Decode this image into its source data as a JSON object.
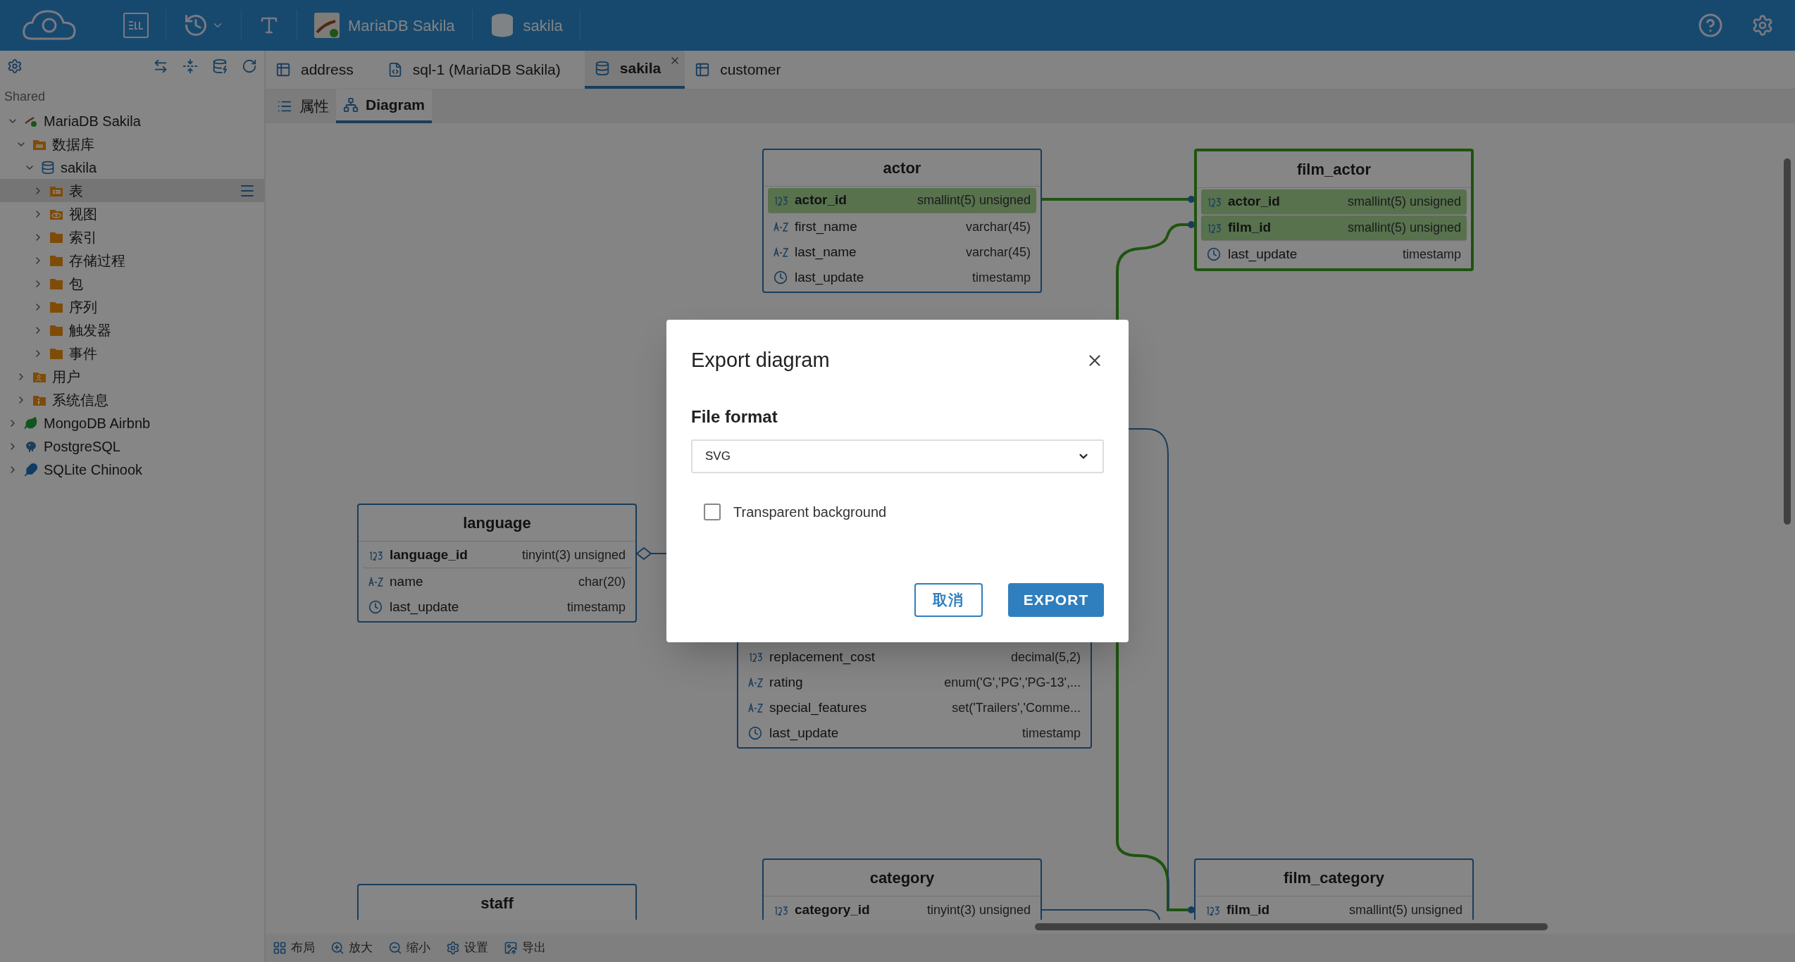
{
  "toolbar": {
    "connection": "MariaDB Sakila",
    "schema": "sakila"
  },
  "sidebar": {
    "section": "Shared",
    "tree": [
      {
        "label": "MariaDB Sakila",
        "kind": "connection",
        "expanded": true,
        "selected": false,
        "children": [
          {
            "label": "数据库",
            "kind": "databases",
            "expanded": true,
            "selected": false,
            "children": [
              {
                "label": "sakila",
                "kind": "database",
                "expanded": true,
                "selected": false,
                "children": [
                  {
                    "label": "表",
                    "kind": "tables",
                    "expanded": false,
                    "selected": true
                  },
                  {
                    "label": "视图",
                    "kind": "views",
                    "expanded": false,
                    "selected": false
                  },
                  {
                    "label": "索引",
                    "kind": "folder",
                    "expanded": false,
                    "selected": false
                  },
                  {
                    "label": "存储过程",
                    "kind": "folder",
                    "expanded": false,
                    "selected": false
                  },
                  {
                    "label": "包",
                    "kind": "folder",
                    "expanded": false,
                    "selected": false
                  },
                  {
                    "label": "序列",
                    "kind": "folder",
                    "expanded": false,
                    "selected": false
                  },
                  {
                    "label": "触发器",
                    "kind": "folder",
                    "expanded": false,
                    "selected": false
                  },
                  {
                    "label": "事件",
                    "kind": "folder",
                    "expanded": false,
                    "selected": false
                  }
                ]
              }
            ]
          },
          {
            "label": "用户",
            "kind": "users",
            "expanded": false,
            "selected": false
          },
          {
            "label": "系统信息",
            "kind": "info",
            "expanded": false,
            "selected": false
          }
        ]
      },
      {
        "label": "MongoDB Airbnb",
        "kind": "mongo",
        "expanded": false,
        "selected": false
      },
      {
        "label": "PostgreSQL",
        "kind": "postgres",
        "expanded": false,
        "selected": false
      },
      {
        "label": "SQLite Chinook",
        "kind": "sqlite",
        "expanded": false,
        "selected": false
      }
    ]
  },
  "tabs": [
    {
      "label": "address",
      "kind": "table",
      "selected": false
    },
    {
      "label": "sql-1 (MariaDB Sakila)",
      "kind": "script",
      "selected": false
    },
    {
      "label": "sakila",
      "kind": "schema",
      "selected": true
    },
    {
      "label": "customer",
      "kind": "table",
      "selected": false
    }
  ],
  "subtabs": [
    {
      "label": "属性",
      "kind": "properties",
      "selected": false
    },
    {
      "label": "Diagram",
      "kind": "diagram",
      "selected": true
    }
  ],
  "diagram": {
    "tables": [
      {
        "name": "actor",
        "highlighted": false,
        "columns": [
          {
            "name": "actor_id",
            "type": "smallint(5) unsigned",
            "kind": "number",
            "key": true,
            "highlighted": true
          },
          {
            "name": "first_name",
            "type": "varchar(45)",
            "kind": "text",
            "key": false,
            "highlighted": false
          },
          {
            "name": "last_name",
            "type": "varchar(45)",
            "kind": "text",
            "key": false,
            "highlighted": false
          },
          {
            "name": "last_update",
            "type": "timestamp",
            "kind": "time",
            "key": false,
            "highlighted": false
          }
        ]
      },
      {
        "name": "film_actor",
        "highlighted": true,
        "columns": [
          {
            "name": "actor_id",
            "type": "smallint(5) unsigned",
            "kind": "number",
            "key": true,
            "highlighted": true
          },
          {
            "name": "film_id",
            "type": "smallint(5) unsigned",
            "kind": "number",
            "key": true,
            "highlighted": true
          },
          {
            "name": "last_update",
            "type": "timestamp",
            "kind": "time",
            "key": false,
            "highlighted": false
          }
        ]
      },
      {
        "name": "language",
        "highlighted": false,
        "columns": [
          {
            "name": "language_id",
            "type": "tinyint(3) unsigned",
            "kind": "number",
            "key": true,
            "highlighted": false
          },
          {
            "name": "name",
            "type": "char(20)",
            "kind": "text",
            "key": false,
            "highlighted": false
          },
          {
            "name": "last_update",
            "type": "timestamp",
            "kind": "time",
            "key": false,
            "highlighted": false
          }
        ]
      },
      {
        "highlighted": false,
        "columns": [
          {
            "name": "replacement_cost",
            "type": "decimal(5,2)",
            "kind": "number",
            "key": false,
            "highlighted": false
          },
          {
            "name": "rating",
            "type": "enum('G','PG','PG-13',...",
            "kind": "text",
            "key": false,
            "highlighted": false
          },
          {
            "name": "special_features",
            "type": "set('Trailers','Comme...",
            "kind": "text",
            "key": false,
            "highlighted": false
          },
          {
            "name": "last_update",
            "type": "timestamp",
            "kind": "time",
            "key": false,
            "highlighted": false
          }
        ]
      },
      {
        "name": "category",
        "highlighted": false,
        "columns": [
          {
            "name": "category_id",
            "type": "tinyint(3) unsigned",
            "kind": "number",
            "key": true,
            "highlighted": false
          }
        ]
      },
      {
        "name": "film_category",
        "highlighted": false,
        "columns": [
          {
            "name": "film_id",
            "type": "smallint(5) unsigned",
            "kind": "number",
            "key": true,
            "highlighted": false
          }
        ]
      },
      {
        "name": "staff",
        "highlighted": false
      }
    ]
  },
  "bottom_toolbar": [
    {
      "label": "布局",
      "kind": "layout"
    },
    {
      "label": "放大",
      "kind": "zoom-in"
    },
    {
      "label": "缩小",
      "kind": "zoom-out"
    },
    {
      "label": "设置",
      "kind": "settings"
    },
    {
      "label": "导出",
      "kind": "export"
    }
  ],
  "dialog": {
    "title": "Export diagram",
    "field_label": "File format",
    "format": "SVG",
    "checkbox": {
      "label": "Transparent background",
      "checked": false
    },
    "buttons": [
      {
        "label": "取消",
        "kind": "secondary"
      },
      {
        "label": "EXPORT",
        "kind": "primary"
      }
    ]
  }
}
